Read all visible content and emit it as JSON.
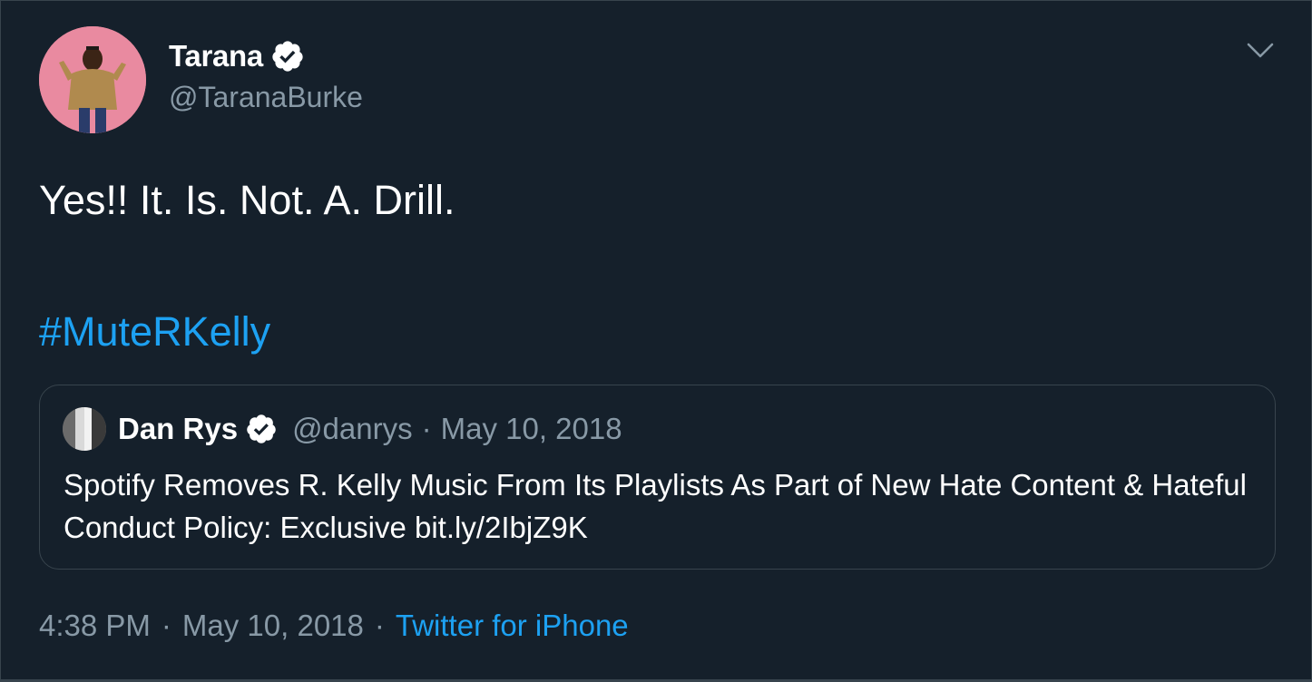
{
  "tweet": {
    "author": {
      "display_name": "Tarana",
      "handle": "@TaranaBurke",
      "verified": true
    },
    "text": "Yes!! It. Is. Not. A. Drill.",
    "hashtag": "#MuteRKelly",
    "quoted": {
      "display_name": "Dan Rys",
      "handle": "@danrys",
      "separator": "·",
      "date": "May 10, 2018",
      "verified": true,
      "text": "Spotify Removes R. Kelly Music From Its Playlists As Part of New Hate Content & Hateful Conduct Policy: Exclusive bit.ly/2IbjZ9K"
    },
    "meta": {
      "time": "4:38 PM",
      "separator": "·",
      "date": "May 10, 2018",
      "source": "Twitter for iPhone"
    }
  },
  "icons": {
    "verified": "verified-badge-icon",
    "menu": "chevron-down-icon"
  },
  "colors": {
    "background": "#15202b",
    "link": "#1da1f2",
    "secondary_text": "#8899a6",
    "border": "#38444d"
  }
}
